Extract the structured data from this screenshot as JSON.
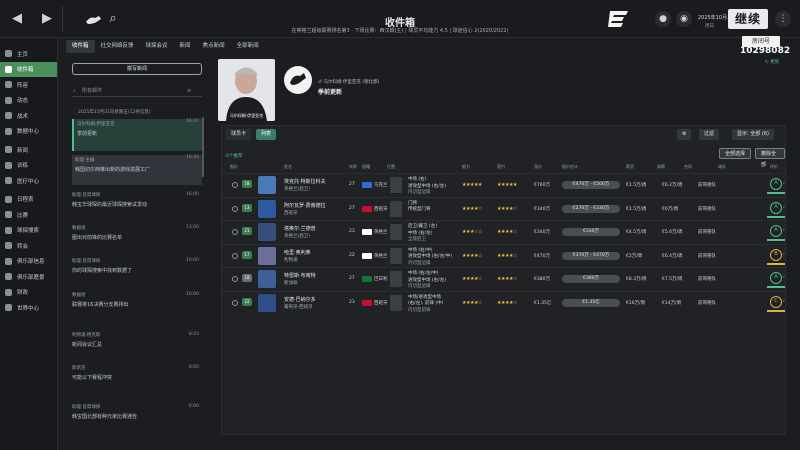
{
  "topbar": {
    "title": "收件箱",
    "subtitle": "在英格兰超级联赛排名第3 · 下场比赛：西汉姆(主) | 球员平均能力 4.5 | 球迷信心 2(2020/2022)",
    "back_icon": "arrow-left-icon",
    "forward_icon": "arrow-right-icon",
    "search_icon": "search-icon",
    "date": "2025年10月...",
    "day": "周日",
    "continue_label": "继续"
  },
  "stream_overlay": {
    "channel": "房间号",
    "number": "10298082"
  },
  "sidebar": {
    "items": [
      {
        "label": "主页",
        "icon": "home-icon"
      },
      {
        "label": "收件箱",
        "icon": "inbox-icon",
        "active": true
      },
      {
        "label": "阵容",
        "icon": "squad-icon"
      },
      {
        "label": "动态",
        "icon": "dynamics-icon"
      },
      {
        "label": "战术",
        "icon": "tactics-icon"
      },
      {
        "label": "数据中心",
        "icon": "data-icon"
      },
      {
        "label": "新闻",
        "icon": "news-icon"
      },
      {
        "label": "训练",
        "icon": "training-icon"
      },
      {
        "label": "医疗中心",
        "icon": "medical-icon"
      },
      {
        "label": "日程表",
        "icon": "calendar-icon"
      },
      {
        "label": "比赛",
        "icon": "match-icon"
      },
      {
        "label": "球探搜索",
        "icon": "scouting-icon"
      },
      {
        "label": "转会",
        "icon": "transfer-icon"
      },
      {
        "label": "俱乐部信息",
        "icon": "club-icon"
      },
      {
        "label": "俱乐部愿景",
        "icon": "vision-icon"
      },
      {
        "label": "财政",
        "icon": "finance-icon"
      },
      {
        "label": "世界中心",
        "icon": "world-icon"
      }
    ]
  },
  "tabs": [
    "收件箱",
    "社交网络反馈",
    "球探会议",
    "新闻",
    "焦点新闻",
    "全部新闻"
  ],
  "inbox": {
    "button": "撰写新闻",
    "search_placeholder": "所有邮件",
    "group_date": "2025年10月31日星期五(12条信息)",
    "messages": [
      {
        "from": "马尔科姆·伊里亚克",
        "subject": "季前更新",
        "time": "16:47",
        "state": "selected"
      },
      {
        "from": "助理·主编",
        "subject": "韩国切尔西推出新的游戏进展工厂",
        "time": "16:34",
        "state": "secondary"
      },
      {
        "from": "助理·首席球探",
        "subject": "韩宝华球探的最近球探搜索试发动",
        "time": "16:00"
      },
      {
        "from": "数据组",
        "subject": "图出对前锋的比赛名单",
        "time": "13:00"
      },
      {
        "from": "助理·首席球探",
        "subject": "你的球探搜索中找到数据了",
        "time": "10:00"
      },
      {
        "from": "数据组",
        "subject": "联赛排16决赛分支赛排出",
        "time": "10:00"
      },
      {
        "from": "利物浦·德克斯",
        "subject": "新闻会议汇总",
        "time": "8:03"
      },
      {
        "from": "斯诺克",
        "subject": "可能以下赛程冲突",
        "time": "8:00"
      },
      {
        "from": "助理·首席球探",
        "subject": "韩宝国北部有种元家比赛通告",
        "time": "6:00"
      }
    ]
  },
  "email": {
    "from": "马尔科姆·伊里亚克",
    "from_role": "(德比郡)",
    "subject": "季前更新",
    "photo_label": "马尔科姆·伊里亚克"
  },
  "panel": {
    "tabs": [
      "球员卡",
      "列表"
    ],
    "count_text": "6个推荐",
    "buttons": {
      "settings": "⚙",
      "filter": "过滤",
      "display": "显示: 全部 (6)"
    },
    "select_all": "全部选择",
    "clear_all": "撤除全部",
    "columns": [
      "报价",
      "",
      "",
      "姓名",
      "年龄",
      "国籍",
      "位置",
      "",
      "能力",
      "潜力",
      "身价",
      "报价估计",
      "薪资",
      "周薪",
      "合同",
      "",
      "球队",
      "",
      "评价"
    ],
    "rows": [
      {
        "badge": "18",
        "name": "埃克托·特斯拉科夫",
        "nat": "英格兰(后卫)",
        "age": "27",
        "club": "乌克兰",
        "pos1": "中场 (右)",
        "pos2": "进攻型中场 (右/左)",
        "pos3": "内切型边锋",
        "ability": "★★★★★",
        "potential": "★★★★★",
        "value": "€760万",
        "est": "€470万 - €500万",
        "wage": "€1.5万/周",
        "contract": "€6.2万/周",
        "team": "前哥德队",
        "rating": "A"
      },
      {
        "badge": "13",
        "name": "阿尔瓦罗·费南德拉",
        "nat": "西班牙",
        "age": "27",
        "club": "西班牙",
        "pos1": "门将",
        "pos2": "传统型门将",
        "pos3": "",
        "ability": "★★★★☆",
        "potential": "★★★★☆",
        "value": "€340万",
        "est": "€270万 - €330万",
        "wage": "€1.5万/周",
        "contract": "€6万/周",
        "team": "前哥德队",
        "rating": "A"
      },
      {
        "badge": "21",
        "name": "塔奥尔·兰德普",
        "nat": "英格兰(后卫)",
        "age": "23",
        "club": "英格兰",
        "pos1": "后卫/翼卫 (左)",
        "pos2": "中场 (右/左)",
        "pos3": "全能后卫",
        "ability": "★★★☆☆",
        "potential": "★★★★☆",
        "value": "€340万",
        "est": "€330万",
        "wage": "€4.5万/周",
        "contract": "€5.6万/周",
        "team": "前哥德队",
        "rating": "A"
      },
      {
        "badge": "17",
        "name": "哈里·奥利弗",
        "nat": "利物浦",
        "age": "22",
        "club": "英格兰",
        "pos1": "中场 (右/中)",
        "pos2": "进攻型中场 (右/左/中)",
        "pos3": "内切型边锋",
        "ability": "★★★★☆",
        "potential": "★★★★☆",
        "value": "€470万",
        "est": "€370万 - €470万",
        "wage": "€2万/周",
        "contract": "€6.4万/周",
        "team": "前哥德队",
        "rating": "B"
      },
      {
        "badge": "18",
        "name": "特雷斯·布南特",
        "nat": "新加坡",
        "age": "27",
        "club": "巴日利",
        "pos1": "中场 (右/左/中)",
        "pos2": "进攻型中场 (右/左)",
        "pos3": "内切型边锋",
        "ability": "★★★★☆",
        "potential": "★★★★☆",
        "value": "€380万",
        "est": "€380万",
        "wage": "€8.3万/周",
        "contract": "€7.5万/周",
        "team": "前哥德队",
        "rating": "A"
      },
      {
        "badge": "22",
        "name": "安德·巴纳尔多",
        "nat": "葡萄牙-西班牙",
        "age": "23",
        "club": "西班牙",
        "pos1": "中场/进攻型中场",
        "pos2": "(右/左), 前锋 (中)",
        "pos3": "内切型前锋",
        "ability": "★★★★☆",
        "potential": "★★★★☆",
        "value": "€1.35亿",
        "est": "€1.35亿",
        "wage": "€16万/周",
        "contract": "€14万/周",
        "team": "前哥德队",
        "rating": "C"
      }
    ]
  },
  "colors": {
    "accent": "#4fc08d",
    "active_nav": "#4b8f5a",
    "bg": "#1b1d21"
  }
}
